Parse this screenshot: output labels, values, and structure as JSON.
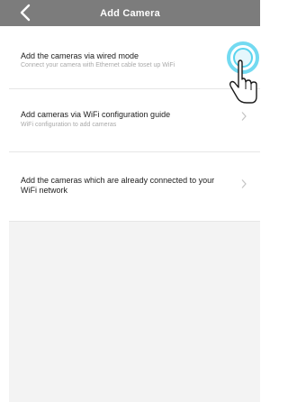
{
  "header": {
    "title": "Add Camera",
    "back_icon": "chevron-left-icon"
  },
  "menu": {
    "items": [
      {
        "title": "Add the cameras via wired mode",
        "subtitle": "Connect your camera with Ethernet cable toset up WiFi"
      },
      {
        "title": "Add cameras via WiFi configuration guide",
        "subtitle": "WiFi configuration to add cameras"
      },
      {
        "title": "Add the cameras which are already connected to your WiFi network"
      }
    ]
  },
  "colors": {
    "nav_bar": "#7c7c7c",
    "background": "#f3f3f3",
    "tap_highlight": "#5ad4ee"
  },
  "icons": {
    "chevron": "chevron-right-icon",
    "tap": "hand-pointer-icon"
  }
}
